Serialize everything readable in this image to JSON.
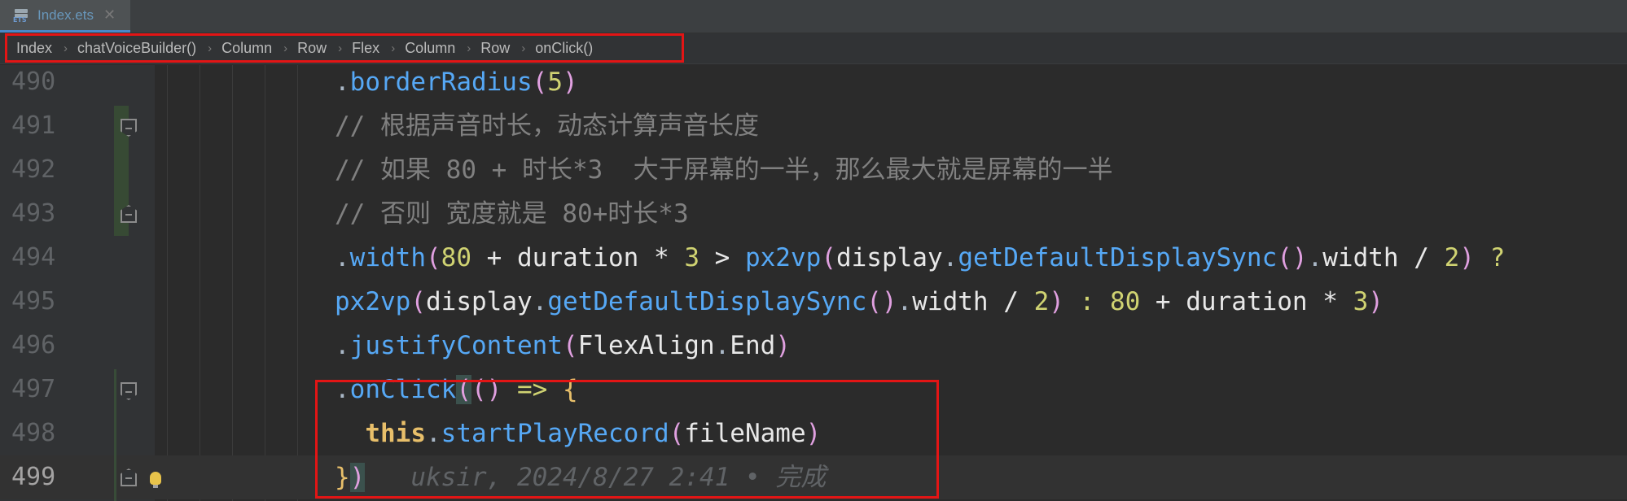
{
  "tab": {
    "file_name": "Index.ets",
    "close_glyph": "✕",
    "icon": "ets-file-icon",
    "icon_text": "ETS"
  },
  "breadcrumb": [
    "Index",
    "chatVoiceBuilder()",
    "Column",
    "Row",
    "Flex",
    "Column",
    "Row",
    "onClick()"
  ],
  "separator": "›",
  "lines": [
    {
      "number": "490",
      "tokens": [
        {
          "t": ".",
          "c": "c-dot"
        },
        {
          "t": "borderRadius",
          "c": "c-fn"
        },
        {
          "t": "(",
          "c": "c-paren"
        },
        {
          "t": "5",
          "c": "c-num"
        },
        {
          "t": ")",
          "c": "c-paren"
        }
      ]
    },
    {
      "number": "491",
      "tokens": [
        {
          "t": "// 根据声音时长，动态计算声音长度",
          "c": "c-comment"
        }
      ]
    },
    {
      "number": "492",
      "tokens": [
        {
          "t": "// 如果 80 + 时长*3  大于屏幕的一半，那么最大就是屏幕的一半",
          "c": "c-comment"
        }
      ]
    },
    {
      "number": "493",
      "tokens": [
        {
          "t": "// 否则 宽度就是 80+时长*3",
          "c": "c-comment"
        }
      ]
    },
    {
      "number": "494",
      "tokens": [
        {
          "t": ".",
          "c": "c-dot"
        },
        {
          "t": "width",
          "c": "c-fn"
        },
        {
          "t": "(",
          "c": "c-paren"
        },
        {
          "t": "80",
          "c": "c-num"
        },
        {
          "t": " + ",
          "c": "c-op"
        },
        {
          "t": "duration",
          "c": "c-id"
        },
        {
          "t": " * ",
          "c": "c-op"
        },
        {
          "t": "3",
          "c": "c-num"
        },
        {
          "t": " > ",
          "c": "c-op"
        },
        {
          "t": "px2vp",
          "c": "c-fn"
        },
        {
          "t": "(",
          "c": "c-paren"
        },
        {
          "t": "display",
          "c": "c-id"
        },
        {
          "t": ".",
          "c": "c-dot"
        },
        {
          "t": "getDefaultDisplaySync",
          "c": "c-fn"
        },
        {
          "t": "()",
          "c": "c-paren"
        },
        {
          "t": ".",
          "c": "c-dot"
        },
        {
          "t": "width",
          "c": "c-id"
        },
        {
          "t": " / ",
          "c": "c-op"
        },
        {
          "t": "2",
          "c": "c-num"
        },
        {
          "t": ")",
          "c": "c-paren"
        },
        {
          "t": " ?",
          "c": "c-tern"
        }
      ]
    },
    {
      "number": "495",
      "tokens": [
        {
          "t": "px2vp",
          "c": "c-fn"
        },
        {
          "t": "(",
          "c": "c-paren"
        },
        {
          "t": "display",
          "c": "c-id"
        },
        {
          "t": ".",
          "c": "c-dot"
        },
        {
          "t": "getDefaultDisplaySync",
          "c": "c-fn"
        },
        {
          "t": "()",
          "c": "c-paren"
        },
        {
          "t": ".",
          "c": "c-dot"
        },
        {
          "t": "width",
          "c": "c-id"
        },
        {
          "t": " / ",
          "c": "c-op"
        },
        {
          "t": "2",
          "c": "c-num"
        },
        {
          "t": ")",
          "c": "c-paren"
        },
        {
          "t": " : ",
          "c": "c-tern"
        },
        {
          "t": "80",
          "c": "c-num"
        },
        {
          "t": " + ",
          "c": "c-op"
        },
        {
          "t": "duration",
          "c": "c-id"
        },
        {
          "t": " * ",
          "c": "c-op"
        },
        {
          "t": "3",
          "c": "c-num"
        },
        {
          "t": ")",
          "c": "c-paren"
        }
      ]
    },
    {
      "number": "496",
      "tokens": [
        {
          "t": ".",
          "c": "c-dot"
        },
        {
          "t": "justifyContent",
          "c": "c-fn"
        },
        {
          "t": "(",
          "c": "c-paren"
        },
        {
          "t": "FlexAlign",
          "c": "c-id"
        },
        {
          "t": ".",
          "c": "c-dot"
        },
        {
          "t": "End",
          "c": "c-id"
        },
        {
          "t": ")",
          "c": "c-paren"
        }
      ]
    },
    {
      "number": "497",
      "tokens": [
        {
          "t": ".",
          "c": "c-dot"
        },
        {
          "t": "onClick",
          "c": "c-fn"
        },
        {
          "t": "(",
          "c": "c-paren brace-hl"
        },
        {
          "t": "()",
          "c": "c-paren"
        },
        {
          "t": " => ",
          "c": "c-tern"
        },
        {
          "t": "{",
          "c": "c-brace"
        }
      ]
    },
    {
      "number": "498",
      "tokens": [
        {
          "t": "  ",
          "c": "c-op"
        },
        {
          "t": "this",
          "c": "c-kw"
        },
        {
          "t": ".",
          "c": "c-dot"
        },
        {
          "t": "startPlayRecord",
          "c": "c-fn"
        },
        {
          "t": "(",
          "c": "c-paren"
        },
        {
          "t": "fileName",
          "c": "c-id"
        },
        {
          "t": ")",
          "c": "c-paren"
        }
      ]
    },
    {
      "number": "499",
      "current": true,
      "tokens": [
        {
          "t": "}",
          "c": "c-brace"
        },
        {
          "t": ")",
          "c": "c-paren brace-hl"
        },
        {
          "t": "   uksir, 2024/8/27 2:41 • 完成",
          "c": "blame"
        }
      ]
    }
  ],
  "colors": {
    "highlight_box": "#e31515",
    "background": "#2b2b2b"
  }
}
